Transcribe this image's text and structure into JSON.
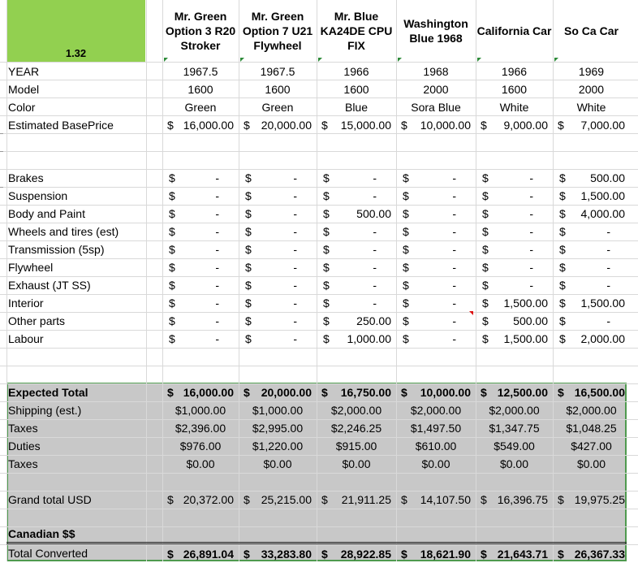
{
  "sheet": {
    "corner_label": "1.32",
    "colors": {
      "corner_fill": "#92d050",
      "summary_fill": "#c8c8c8",
      "border_green": "#4f9a4f"
    },
    "columns": [
      "Mr. Green Option 3 R20 Stroker",
      "Mr. Green Option 7 U21 Flywheel",
      "Mr. Blue KA24DE CPU FIX",
      "Washington Blue 1968",
      "California Car",
      "So Ca Car"
    ],
    "info_rows": [
      {
        "label": "YEAR",
        "values": [
          "1967.5",
          "1967.5",
          "1966",
          "1968",
          "1966",
          "1969"
        ]
      },
      {
        "label": "Model",
        "values": [
          "1600",
          "1600",
          "1600",
          "2000",
          "1600",
          "2000"
        ]
      },
      {
        "label": "Color",
        "values": [
          "Green",
          "Green",
          "Blue",
          "Sora Blue",
          "White",
          "White"
        ]
      }
    ],
    "base_price": {
      "label": "Estimated BasePrice",
      "values": [
        "16,000.00",
        "20,000.00",
        "15,000.00",
        "10,000.00",
        "9,000.00",
        "7,000.00"
      ]
    },
    "cost_rows": [
      {
        "label": "Brakes",
        "values": [
          "-",
          "-",
          "-",
          "-",
          "-",
          "500.00"
        ]
      },
      {
        "label": "Suspension",
        "values": [
          "-",
          "-",
          "-",
          "-",
          "-",
          "1,500.00"
        ]
      },
      {
        "label": "Body and Paint",
        "values": [
          "-",
          "-",
          "500.00",
          "-",
          "-",
          "4,000.00"
        ]
      },
      {
        "label": "Wheels and  tires (est)",
        "values": [
          "-",
          "-",
          "-",
          "-",
          "-",
          "-"
        ]
      },
      {
        "label": "Transmission (5sp)",
        "values": [
          "-",
          "-",
          "-",
          "-",
          "-",
          "-"
        ]
      },
      {
        "label": "Flywheel",
        "values": [
          "-",
          "-",
          "-",
          "-",
          "-",
          "-"
        ]
      },
      {
        "label": "Exhaust (JT SS)",
        "values": [
          "-",
          "-",
          "-",
          "-",
          "-",
          "-"
        ]
      },
      {
        "label": "Interior",
        "values": [
          "-",
          "-",
          "-",
          "-",
          "1,500.00",
          "1,500.00"
        ]
      },
      {
        "label": "Other parts",
        "values": [
          "-",
          "-",
          "250.00",
          "-",
          "500.00",
          "-"
        ]
      },
      {
        "label": "Labour",
        "values": [
          "-",
          "-",
          "1,000.00",
          "-",
          "1,500.00",
          "2,000.00"
        ]
      }
    ],
    "expected_total": {
      "label": "Expected Total",
      "values": [
        "16,000.00",
        "20,000.00",
        "16,750.00",
        "10,000.00",
        "12,500.00",
        "16,500.00"
      ]
    },
    "fee_rows": [
      {
        "label": "Shipping (est.)",
        "values": [
          "$1,000.00",
          "$1,000.00",
          "$2,000.00",
          "$2,000.00",
          "$2,000.00",
          "$2,000.00"
        ]
      },
      {
        "label": "Taxes",
        "values": [
          "$2,396.00",
          "$2,995.00",
          "$2,246.25",
          "$1,497.50",
          "$1,347.75",
          "$1,048.25"
        ]
      },
      {
        "label": "Duties",
        "values": [
          "$976.00",
          "$1,220.00",
          "$915.00",
          "$610.00",
          "$549.00",
          "$427.00"
        ]
      },
      {
        "label": "Taxes",
        "values": [
          "$0.00",
          "$0.00",
          "$0.00",
          "$0.00",
          "$0.00",
          "$0.00"
        ]
      }
    ],
    "grand_total": {
      "label": "Grand total USD",
      "values": [
        "20,372.00",
        "25,215.00",
        "21,911.25",
        "14,107.50",
        "16,396.75",
        "19,975.25"
      ]
    },
    "canadian_label": "Canadian $$",
    "total_converted": {
      "label": "Total Converted",
      "values": [
        "26,891.04",
        "33,283.80",
        "28,922.85",
        "18,621.90",
        "21,643.71",
        "26,367.33"
      ]
    },
    "currency_symbol": "$"
  }
}
